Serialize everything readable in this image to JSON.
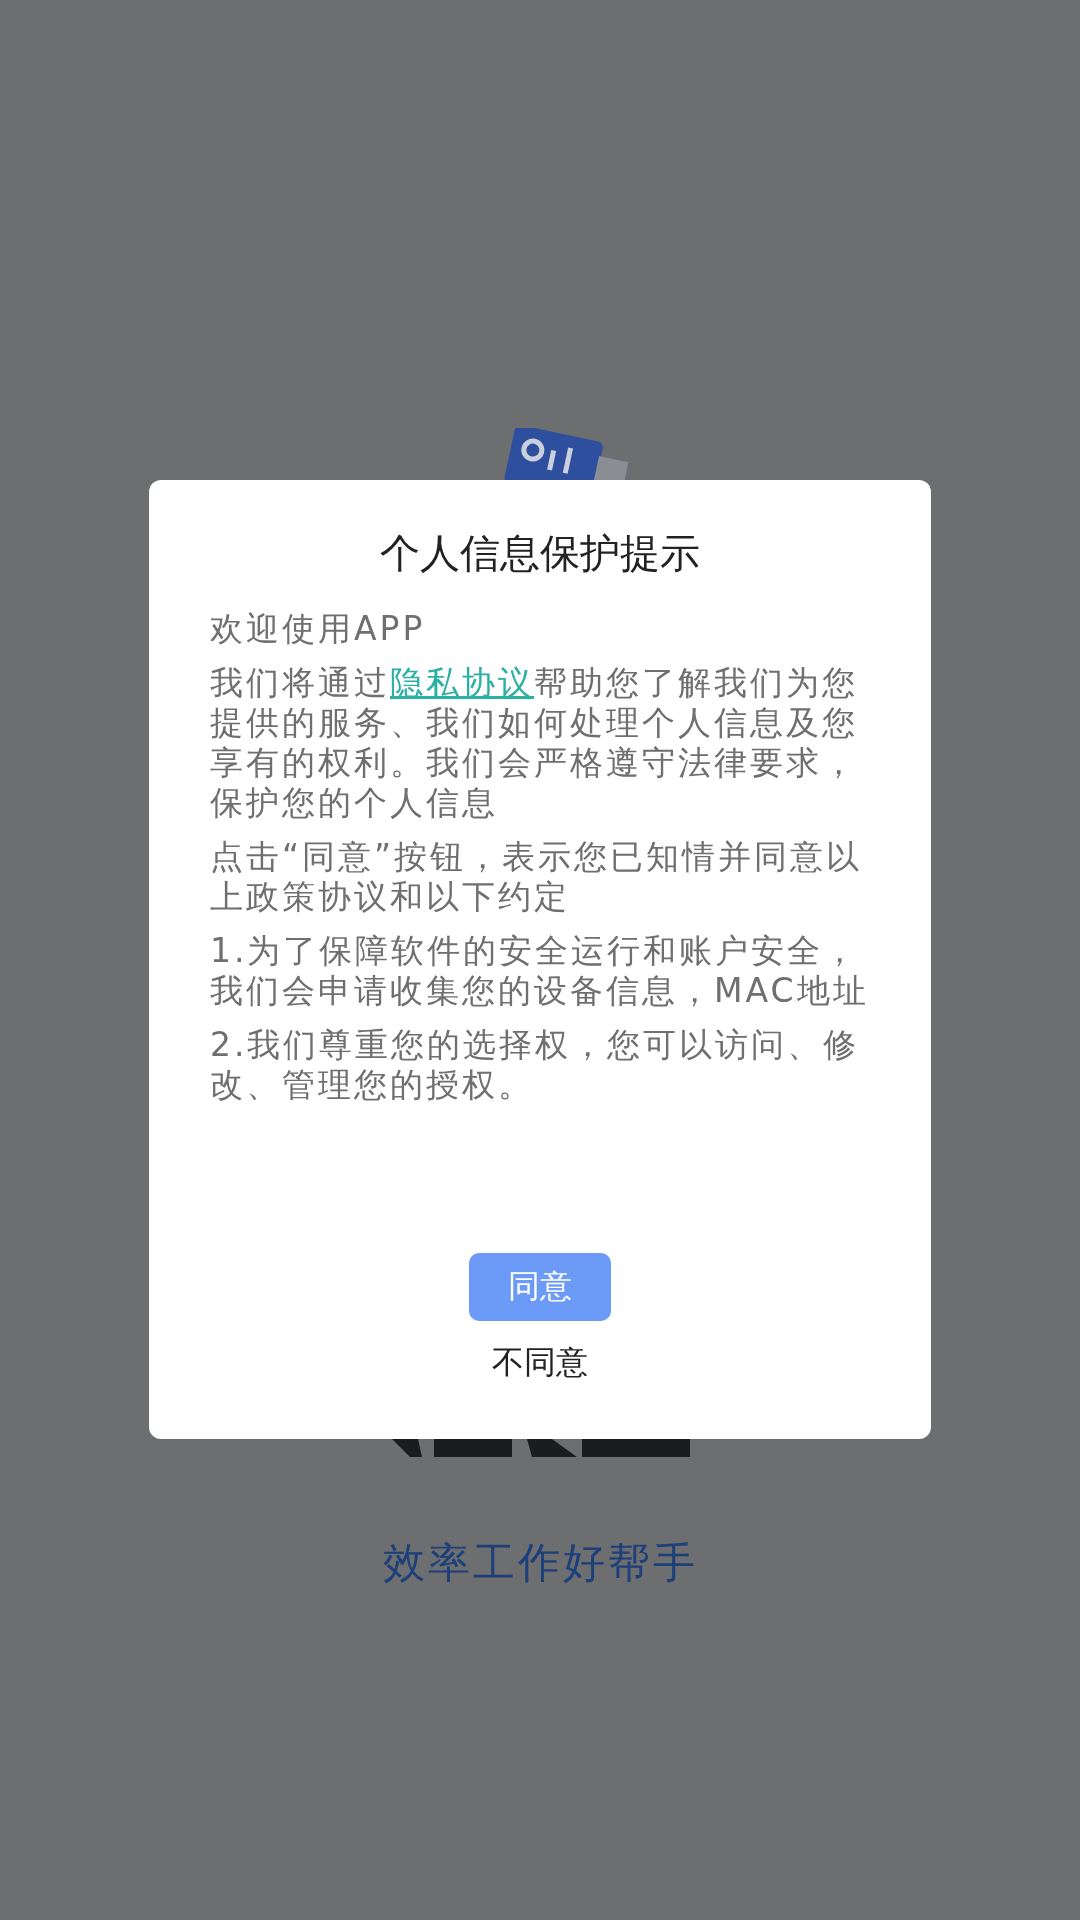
{
  "dialog": {
    "title": "个人信息保护提示",
    "paragraphs": [
      {
        "parts": [
          {
            "kind": "plain",
            "text": "欢迎使用APP"
          }
        ]
      },
      {
        "parts": [
          {
            "kind": "plain",
            "text": "我们将通过"
          },
          {
            "kind": "link",
            "text": "隐私协议"
          },
          {
            "kind": "plain",
            "text": "帮助您了解我们为您提供的服务、我们如何处理个人信息及您享有的权利。我们会严格遵守法律要求，保护您的个人信息"
          }
        ]
      },
      {
        "parts": [
          {
            "kind": "plain",
            "text": "点击“同意”按钮，表示您已知情并同意以上政策协议和以下约定"
          }
        ]
      },
      {
        "parts": [
          {
            "kind": "plain",
            "text": "1.为了保障软件的安全运行和账户安全，我们会申请收集您的设备信息，MAC地址"
          }
        ]
      },
      {
        "parts": [
          {
            "kind": "plain",
            "text": "2.我们尊重您的选择权，您可以访问、修改、管理您的授权。"
          }
        ]
      }
    ],
    "buttons": [
      {
        "kind": "primary",
        "label": "同意"
      },
      {
        "kind": "text",
        "label": "不同意"
      }
    ]
  },
  "background": {
    "tagline": "效率工作好帮手"
  }
}
